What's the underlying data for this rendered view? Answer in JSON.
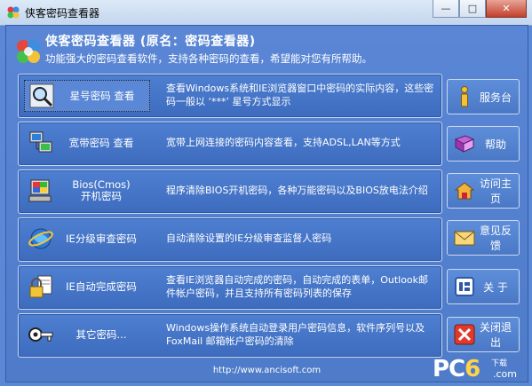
{
  "window": {
    "title": "侠客密码查看器",
    "minimize": "—",
    "maximize": "□",
    "close": "✕"
  },
  "header": {
    "title": "侠客密码查看器 (原名：密码查看器)",
    "subtitle": "功能强大的密码查看软件，支持各种密码的查看，希望能对您有所帮助。"
  },
  "rows": [
    {
      "label": "星号密码 查看",
      "label2": "",
      "desc": "查看Windows系统和IE浏览器窗口中密码的实际内容，这些密码一般以 ‘***’ 星号方式显示",
      "icon": "magnifier-icon"
    },
    {
      "label": "宽带密码 查看",
      "label2": "",
      "desc": "宽带上网连接的密码内容查看，支持ADSL,LAN等方式",
      "icon": "network-computer-icon"
    },
    {
      "label": "Bios(Cmos)",
      "label2": "开机密码",
      "desc": "程序清除BIOS开机密码，各种万能密码以及BIOS放电法介绍",
      "icon": "bios-computer-icon"
    },
    {
      "label": "IE分级审查密码",
      "label2": "",
      "desc": "自动清除设置的IE分级审查监督人密码",
      "icon": "ie-globe-icon"
    },
    {
      "label": "IE自动完成密码",
      "label2": "",
      "desc": "查看IE浏览器自动完成的密码，自动完成的表单，Outlook邮件帐户密码，并且支持所有密码列表的保存",
      "icon": "lock-document-icon"
    },
    {
      "label": "其它密码...",
      "label2": "",
      "desc": "Windows操作系统自动登录用户密码信息，软件序列号以及FoxMail 邮箱帐户密码的清除",
      "icon": "key-icon"
    }
  ],
  "side": [
    {
      "label": "服务台",
      "icon": "info-icon"
    },
    {
      "label": "帮助",
      "icon": "help-book-icon"
    },
    {
      "label": "访问主页",
      "icon": "home-icon"
    },
    {
      "label": "意见反馈",
      "icon": "feedback-mail-icon"
    },
    {
      "label": "关 于",
      "icon": "about-icon"
    },
    {
      "label": "关闭退出",
      "icon": "exit-icon"
    }
  ],
  "footer": {
    "url": "http://www.ancisoft.com"
  },
  "watermark": {
    "brand": "PC",
    "six": "6",
    "sub": "下载",
    "com": ".com"
  }
}
